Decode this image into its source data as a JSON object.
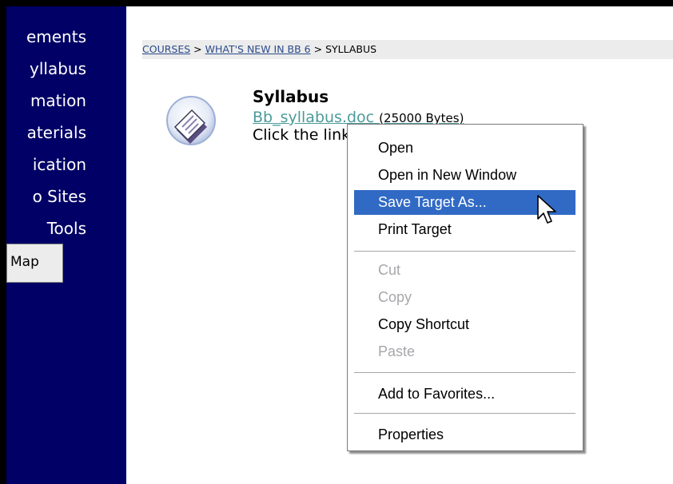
{
  "sidebar": {
    "items": [
      {
        "label": "ements"
      },
      {
        "label": "yllabus"
      },
      {
        "label": "mation"
      },
      {
        "label": "aterials"
      },
      {
        "label": "ication"
      },
      {
        "label": "o Sites"
      },
      {
        "label": "Tools"
      }
    ],
    "map_button": "Map"
  },
  "breadcrumb": {
    "items": [
      "COURSES",
      "WHAT'S NEW IN BB 6",
      "SYLLABUS"
    ],
    "separator": ">"
  },
  "content": {
    "title": "Syllabus",
    "file_link": "Bb_syllabus.doc",
    "file_size": "(25000 Bytes)",
    "instructions": "Click the link to download the syllabus."
  },
  "context_menu": {
    "items": [
      {
        "label": "Open",
        "state": "enabled"
      },
      {
        "label": "Open in New Window",
        "state": "enabled"
      },
      {
        "label": "Save Target As...",
        "state": "highlighted"
      },
      {
        "label": "Print Target",
        "state": "enabled"
      },
      {
        "label": "Cut",
        "state": "disabled"
      },
      {
        "label": "Copy",
        "state": "disabled"
      },
      {
        "label": "Copy Shortcut",
        "state": "enabled"
      },
      {
        "label": "Paste",
        "state": "disabled"
      },
      {
        "label": "Add to Favorites...",
        "state": "enabled"
      },
      {
        "label": "Properties",
        "state": "enabled"
      }
    ]
  },
  "icons": {
    "content_item": "document-item-icon",
    "cursor": "mouse-pointer-icon"
  },
  "colors": {
    "sidebar_bg": "#000066",
    "breadcrumb_bg": "#ececec",
    "menu_highlight": "#316ac5",
    "link": "#4d9a9a"
  }
}
